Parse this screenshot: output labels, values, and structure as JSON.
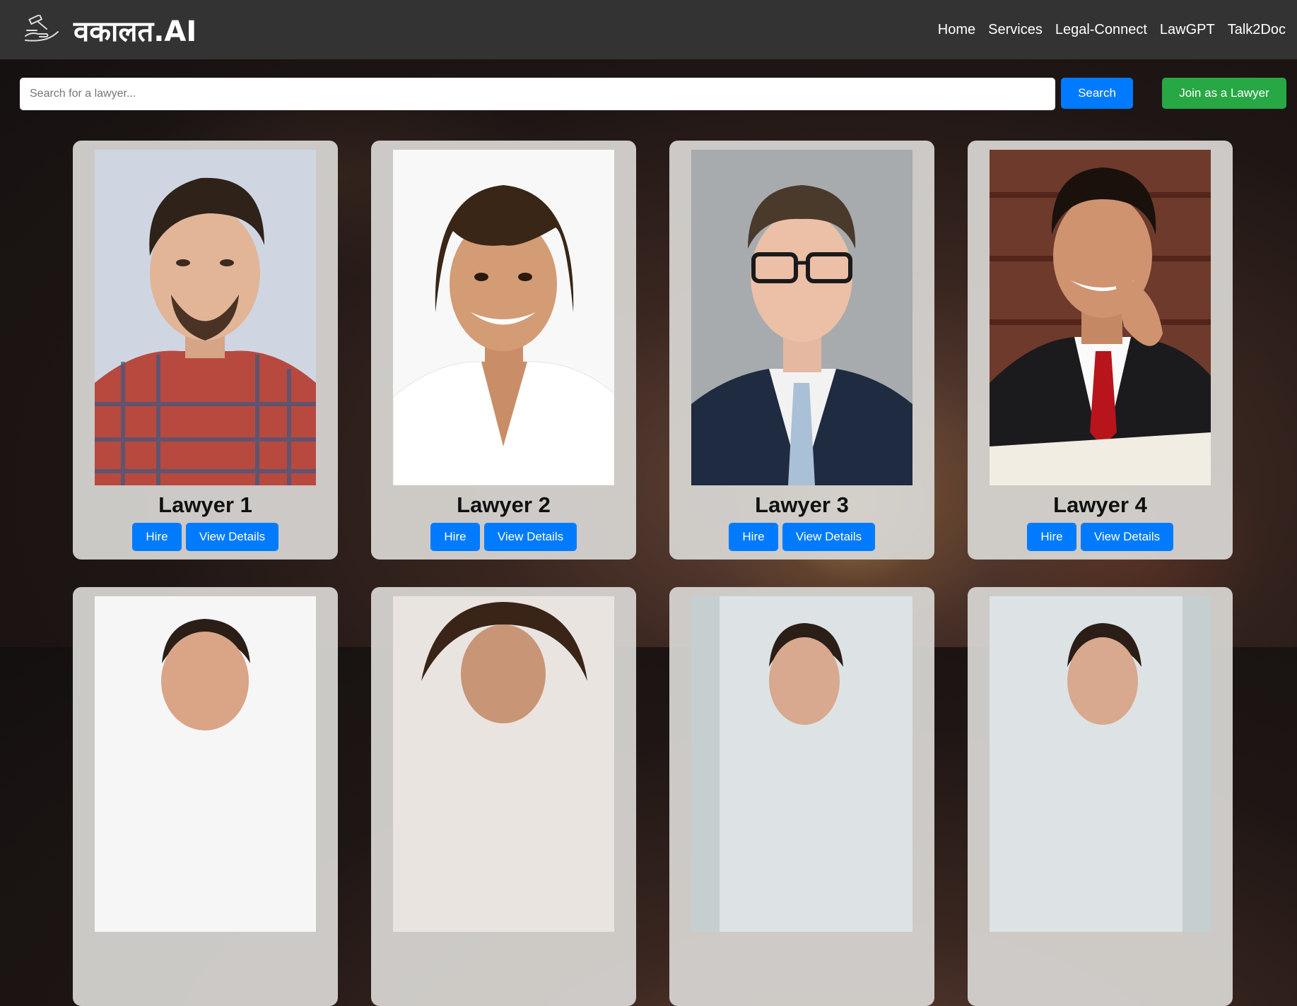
{
  "header": {
    "brand": "वकालत.AI",
    "nav": [
      "Home",
      "Services",
      "Legal-Connect",
      "LawGPT",
      "Talk2Doc"
    ]
  },
  "search": {
    "placeholder": "Search for a lawyer...",
    "value": "",
    "button_label": "Search",
    "join_label": "Join as a Lawyer"
  },
  "lawyers": [
    {
      "name": "Lawyer 1",
      "hire_label": "Hire",
      "details_label": "View Details"
    },
    {
      "name": "Lawyer 2",
      "hire_label": "Hire",
      "details_label": "View Details"
    },
    {
      "name": "Lawyer 3",
      "hire_label": "Hire",
      "details_label": "View Details"
    },
    {
      "name": "Lawyer 4",
      "hire_label": "Hire",
      "details_label": "View Details"
    },
    {
      "name": "",
      "hire_label": "",
      "details_label": ""
    },
    {
      "name": "",
      "hire_label": "",
      "details_label": ""
    },
    {
      "name": "",
      "hire_label": "",
      "details_label": ""
    },
    {
      "name": "",
      "hire_label": "",
      "details_label": ""
    }
  ],
  "colors": {
    "navbar": "#333333",
    "primary": "#007bff",
    "success": "#28a745",
    "card": "#d7d4d1"
  },
  "icons": {
    "brand_logo": "gavel-hand-icon"
  }
}
